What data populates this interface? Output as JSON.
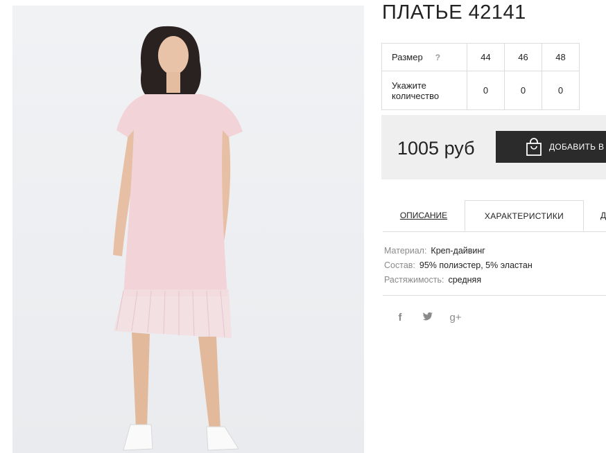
{
  "product": {
    "title": "ПЛАТЬЕ 42141",
    "price": "1005 руб",
    "add_to_cart": "ДОБАВИТЬ В КОРЗИНУ",
    "add_icon": "shopping-bag-icon"
  },
  "sizes": {
    "label": "Размер",
    "help": "?",
    "values": [
      "44",
      "46",
      "48"
    ],
    "quantity_label": "Укажите количество",
    "quantities": [
      "0",
      "0",
      "0"
    ]
  },
  "tabs": [
    {
      "label": "ОПИСАНИЕ"
    },
    {
      "label": "ХАРАКТЕРИСТИКИ"
    },
    {
      "label": "Д"
    }
  ],
  "characteristics": [
    {
      "key": "Материал:",
      "value": "Креп-дайвинг"
    },
    {
      "key": "Состав:",
      "value": "95% полиэстер, 5% эластан"
    },
    {
      "key": "Растяжимость:",
      "value": "средняя"
    }
  ],
  "social": [
    {
      "icon": "facebook-icon",
      "glyph": "f"
    },
    {
      "icon": "twitter-icon",
      "glyph": "t"
    },
    {
      "icon": "google-plus-icon",
      "glyph": "g+"
    }
  ],
  "colors": {
    "button_bg": "#2b2b2b",
    "price_bg": "#efefef",
    "dress": "#f2d3d8"
  }
}
